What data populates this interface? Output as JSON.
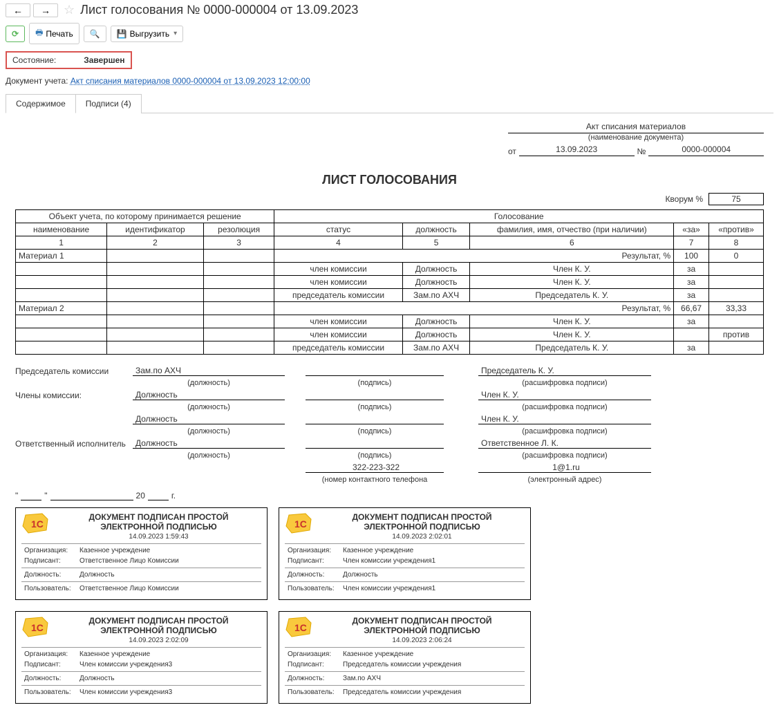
{
  "header": {
    "title": "Лист голосования № 0000-000004 от 13.09.2023"
  },
  "toolbar": {
    "print_label": "Печать",
    "export_label": "Выгрузить"
  },
  "state": {
    "label": "Состояние:",
    "value": "Завершен"
  },
  "doc_ref": {
    "label": "Документ учета:",
    "link": "Акт списания материалов 0000-000004 от 13.09.2023 12:00:00"
  },
  "tabs": {
    "content": "Содержимое",
    "signatures": "Подписи (4)"
  },
  "docmeta": {
    "name": "Акт списания материалов",
    "name_hint": "(наименование документа)",
    "from_label": "от",
    "date": "13.09.2023",
    "num_label": "№",
    "num": "0000-000004"
  },
  "big_title": "ЛИСТ ГОЛОСОВАНИЯ",
  "quorum": {
    "label": "Кворум %",
    "value": "75"
  },
  "table": {
    "group1": "Объект учета, по которому принимается решение",
    "group2": "Голосование",
    "h_name": "наименование",
    "h_id": "идентификатор",
    "h_res": "резолюция",
    "h_status": "статус",
    "h_pos": "должность",
    "h_fio": "фамилия, имя, отчество (при наличии)",
    "h_for": "«за»",
    "h_against": "«против»",
    "n1": "1",
    "n2": "2",
    "n3": "3",
    "n4": "4",
    "n5": "5",
    "n6": "6",
    "n7": "7",
    "n8": "8",
    "result_label": "Результат, %",
    "rows": [
      {
        "mat": "Материал 1",
        "for": "100",
        "against": "0",
        "members": [
          {
            "status": "член комиссии",
            "pos": "Должность",
            "fio": "Член К. У.",
            "vote_for": "за",
            "vote_ag": ""
          },
          {
            "status": "член комиссии",
            "pos": "Должность",
            "fio": "Член К. У.",
            "vote_for": "за",
            "vote_ag": ""
          },
          {
            "status": "председатель комиссии",
            "pos": "Зам.по АХЧ",
            "fio": "Председатель К. У.",
            "vote_for": "за",
            "vote_ag": ""
          }
        ]
      },
      {
        "mat": "Материал 2",
        "for": "66,67",
        "against": "33,33",
        "members": [
          {
            "status": "член комиссии",
            "pos": "Должность",
            "fio": "Член К. У.",
            "vote_for": "за",
            "vote_ag": ""
          },
          {
            "status": "член комиссии",
            "pos": "Должность",
            "fio": "Член К. У.",
            "vote_for": "",
            "vote_ag": "против"
          },
          {
            "status": "председатель комиссии",
            "pos": "Зам.по АХЧ",
            "fio": "Председатель К. У.",
            "vote_for": "за",
            "vote_ag": ""
          }
        ]
      }
    ]
  },
  "sign": {
    "chair_label": "Председатель комиссии",
    "members_label": "Члены комиссии:",
    "resp_label": "Ответственный исполнитель",
    "pos_hint": "(должность)",
    "sig_hint": "(подпись)",
    "fio_hint": "(расшифровка подписи)",
    "phone_hint": "(номер контактного телефона",
    "email_hint": "(электронный адрес)",
    "chair_pos": "Зам.по АХЧ",
    "chair_fio": "Председатель К. У.",
    "m1_pos": "Должность",
    "m1_fio": "Член К. У.",
    "m2_pos": "Должность",
    "m2_fio": "Член К. У.",
    "resp_pos": "Должность",
    "resp_fio": "Ответственное Л. К.",
    "phone": "322-223-322",
    "email": "1@1.ru"
  },
  "dateline": {
    "q1": "\"",
    "q2": "\"",
    "y20": "20",
    "y_suffix": "г."
  },
  "stamps": {
    "title": "ДОКУМЕНТ ПОДПИСАН ПРОСТОЙ ЭЛЕКТРОННОЙ ПОДПИСЬЮ",
    "org_label": "Организация:",
    "signer_label": "Подписант:",
    "pos_label": "Должность:",
    "user_label": "Пользователь:",
    "items": [
      {
        "dt": "14.09.2023 1:59:43",
        "org": "Казенное учреждение",
        "signer": "Ответственное Лицо Комиссии",
        "pos": "Должность",
        "user": "Ответственное Лицо Комиссии"
      },
      {
        "dt": "14.09.2023 2:02:01",
        "org": "Казенное учреждение",
        "signer": "Член комиссии учреждения1",
        "pos": "Должность",
        "user": "Член комиссии учреждения1"
      },
      {
        "dt": "14.09.2023 2:02:09",
        "org": "Казенное учреждение",
        "signer": "Член комиссии учреждения3",
        "pos": "Должность",
        "user": "Член комиссии учреждения3"
      },
      {
        "dt": "14.09.2023 2:06:24",
        "org": "Казенное учреждение",
        "signer": "Председатель комиссии учреждения",
        "pos": "Зам.по АХЧ",
        "user": "Председатель комиссии учреждения"
      }
    ]
  }
}
